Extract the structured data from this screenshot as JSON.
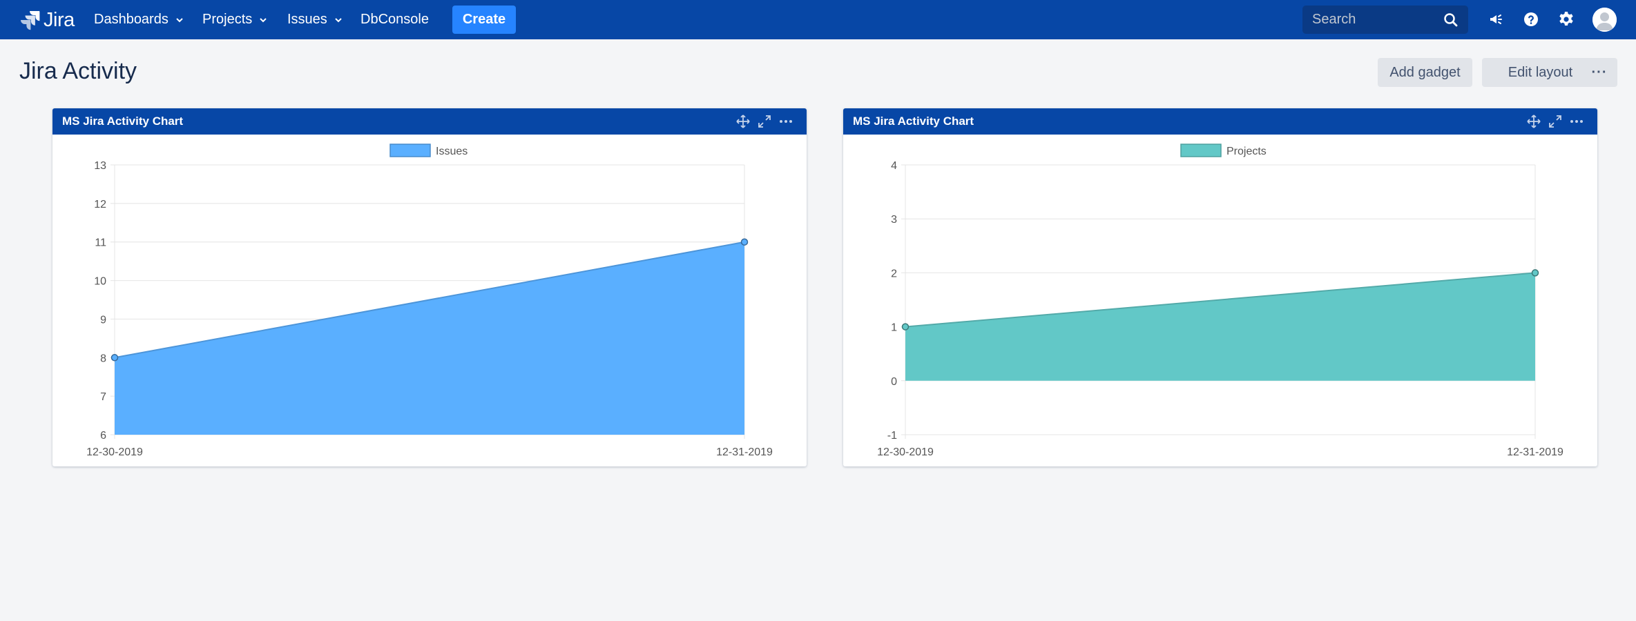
{
  "nav": {
    "logo_text": "Jira",
    "items": [
      {
        "label": "Dashboards",
        "dropdown": true
      },
      {
        "label": "Projects",
        "dropdown": true
      },
      {
        "label": "Issues",
        "dropdown": true
      },
      {
        "label": "DbConsole",
        "dropdown": false
      }
    ],
    "create_label": "Create",
    "search_placeholder": "Search",
    "icons": [
      "megaphone-icon",
      "help-icon",
      "gear-icon",
      "avatar"
    ]
  },
  "page": {
    "title": "Jira Activity",
    "buttons": [
      "Add gadget",
      "Edit layout",
      "···"
    ]
  },
  "gadgets": [
    {
      "title": "MS Jira Activity Chart"
    },
    {
      "title": "MS Jira Activity Chart"
    }
  ],
  "chart_data": [
    {
      "type": "area",
      "x": [
        "12-30-2019",
        "12-31-2019"
      ],
      "series": [
        {
          "name": "Issues",
          "values": [
            8,
            11
          ],
          "color": "#5aafff"
        }
      ],
      "ylim": [
        6,
        13
      ],
      "yticks": [
        6,
        7,
        8,
        9,
        10,
        11,
        12,
        13
      ],
      "legend": "top-center",
      "grid": true
    },
    {
      "type": "area",
      "x": [
        "12-30-2019",
        "12-31-2019"
      ],
      "series": [
        {
          "name": "Projects",
          "values": [
            1,
            2
          ],
          "color": "#62c8c7"
        }
      ],
      "ylim": [
        -1,
        4
      ],
      "yticks": [
        -1,
        0,
        1,
        2,
        3,
        4
      ],
      "legend": "top-center",
      "grid": true
    }
  ],
  "colors": {
    "nav_bg": "#0747a6",
    "create_btn": "#2684ff",
    "issues_fill": "#5aafff",
    "projects_fill": "#62c8c7"
  }
}
